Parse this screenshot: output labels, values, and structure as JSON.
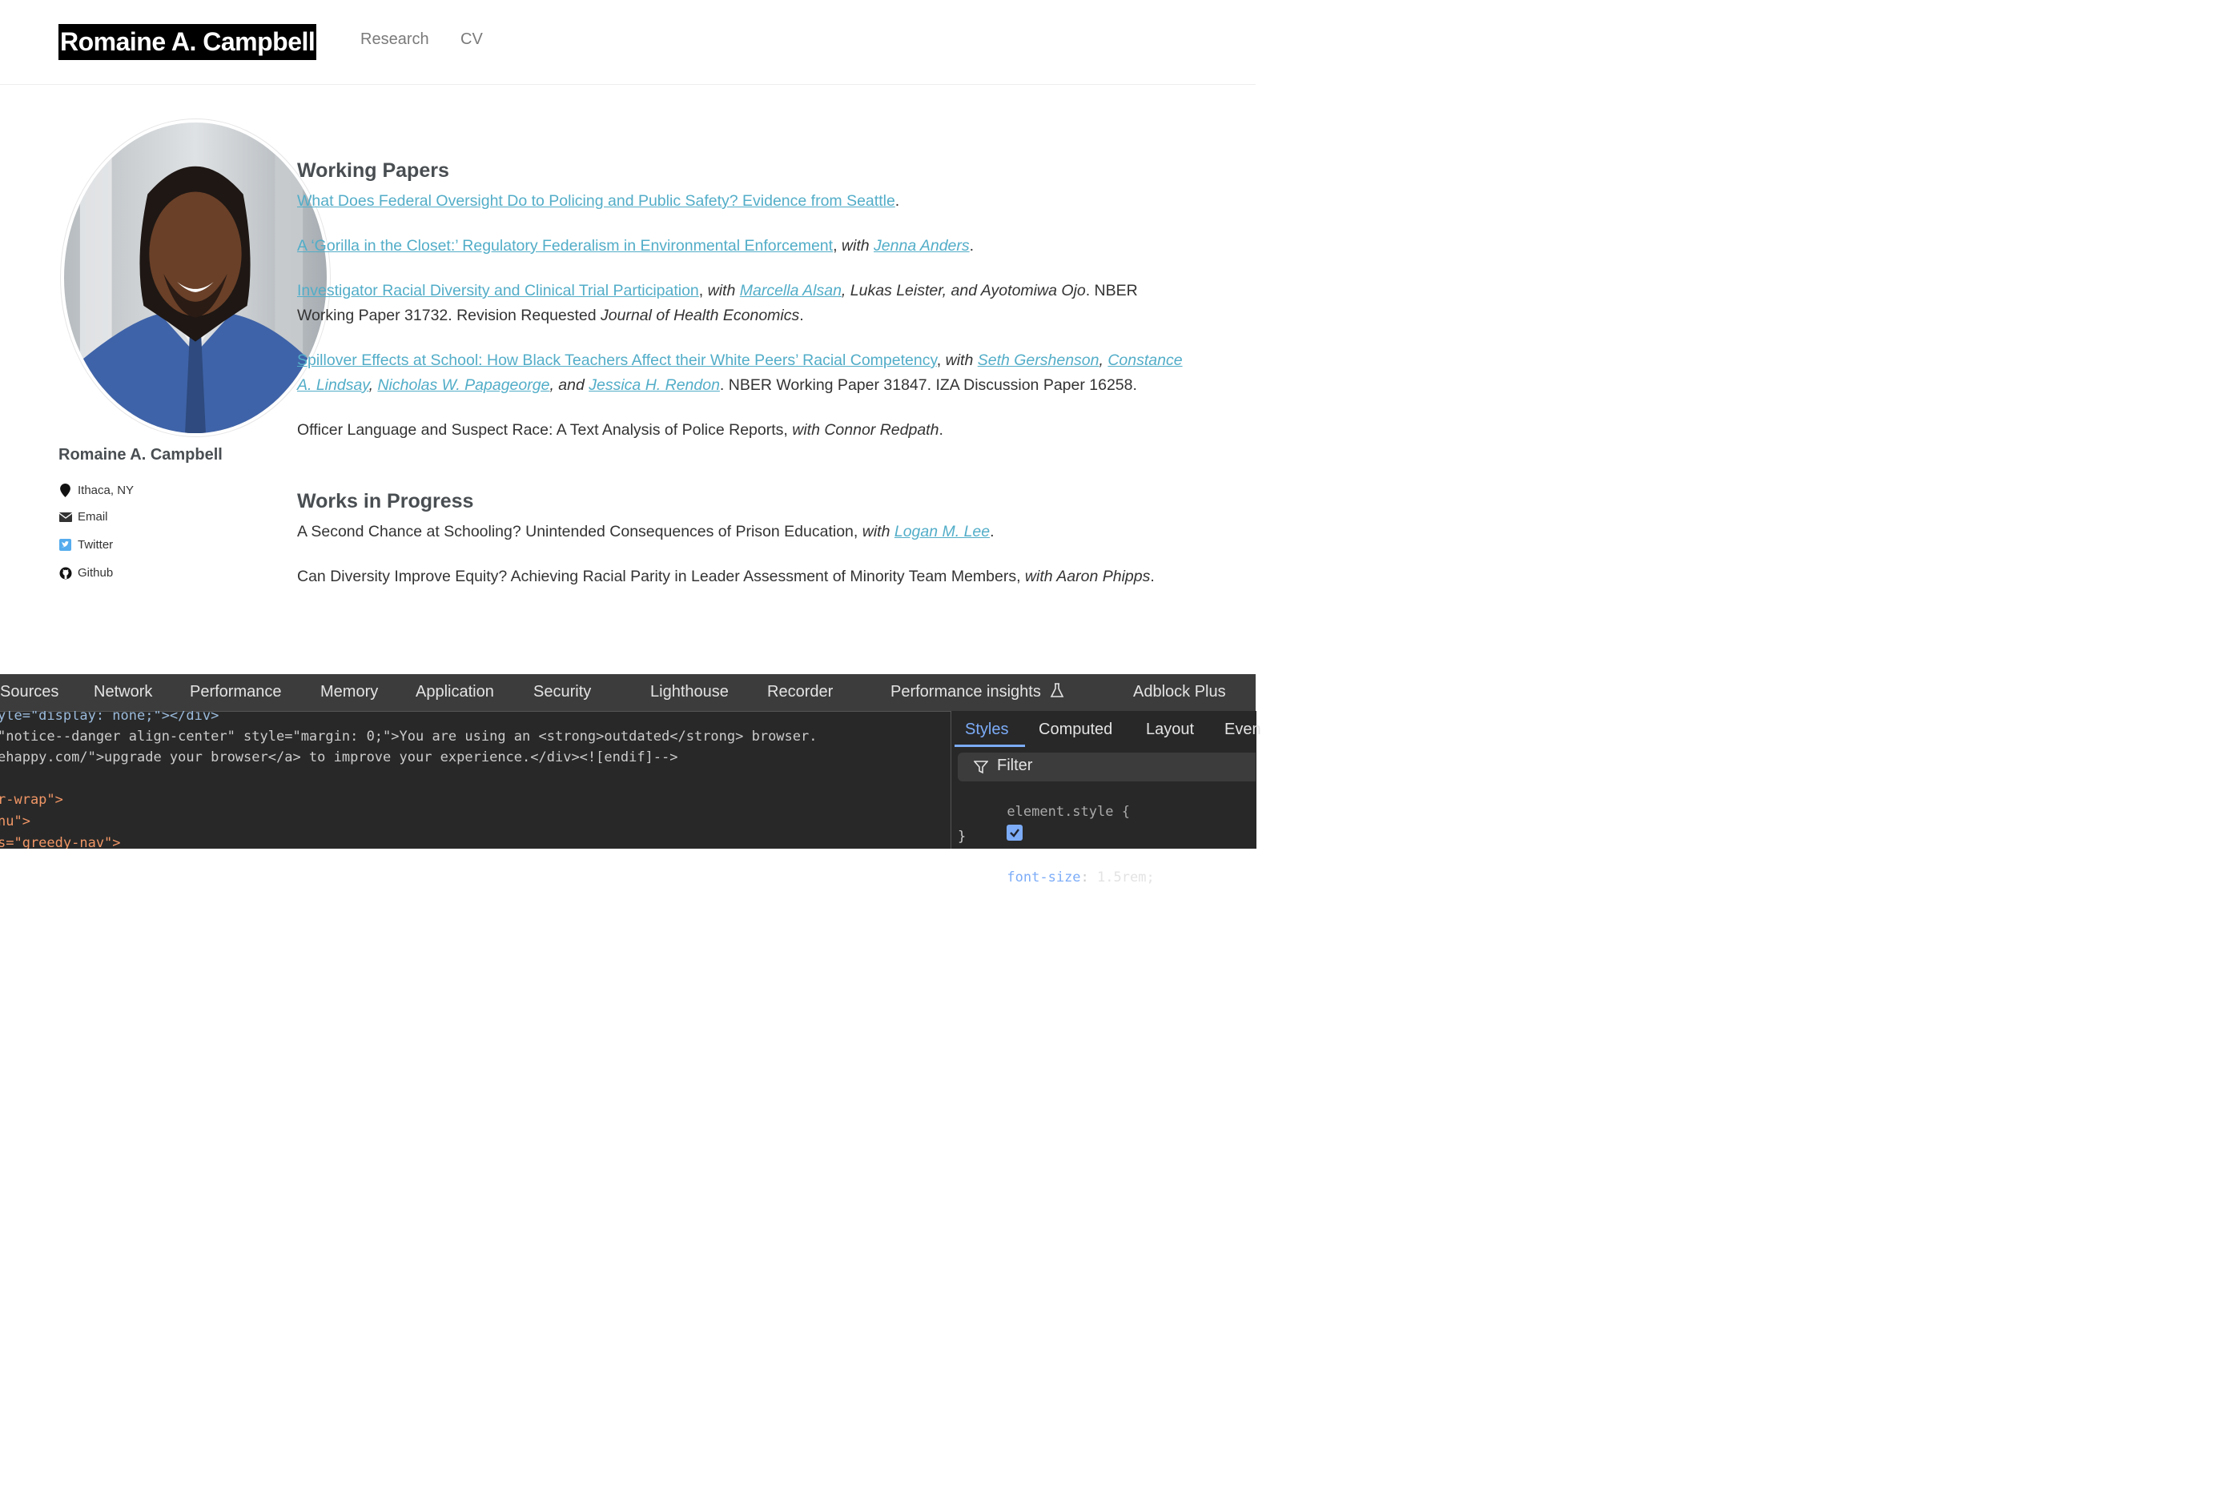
{
  "header": {
    "site_title": "Romaine A. Campbell",
    "nav": [
      {
        "label": "Research"
      },
      {
        "label": "CV"
      }
    ]
  },
  "sidebar": {
    "name": "Romaine A. Campbell",
    "links": [
      {
        "label": "Ithaca, NY",
        "icon": "map-marker-icon"
      },
      {
        "label": "Email",
        "icon": "envelope-icon"
      },
      {
        "label": "Twitter",
        "icon": "twitter-icon"
      },
      {
        "label": "Github",
        "icon": "github-icon"
      }
    ]
  },
  "main": {
    "working_papers_heading": "Working Papers",
    "wp1": {
      "title": "What Does Federal Oversight Do to Policing and Public Safety? Evidence from Seattle"
    },
    "wp2": {
      "title": "A ‘Gorilla in the Closet:’ Regulatory Federalism in Environmental Enforcement",
      "with": "with",
      "coauthor": "Jenna Anders"
    },
    "wp3": {
      "title": "Investigator Racial Diversity and Clinical Trial Participation",
      "with": "with",
      "coauthor1": "Marcella Alsan",
      "rest": ", Lukas Leister, and Ayotomiwa Ojo",
      "note": ". NBER Working Paper 31732. Revision Requested ",
      "journal": "Journal of Health Economics"
    },
    "wp4": {
      "title": "Spillover Effects at School: How Black Teachers Affect their White Peers’ Racial Competency",
      "with": "with",
      "coauthors": [
        "Seth Gershenson",
        "Constance A. Lindsay",
        "Nicholas W. Papageorge",
        "Jessica H. Rendon"
      ],
      "and": "and",
      "note": ". NBER Working Paper 31847. IZA Discussion Paper 16258."
    },
    "wp5": {
      "title": "Officer Language and Suspect Race: A Text Analysis of Police Reports, ",
      "authors": "with Connor Redpath"
    },
    "works_in_progress_heading": "Works in Progress",
    "wip1": {
      "title": "A Second Chance at Schooling? Unintended Consequences of Prison Education, ",
      "with": "with",
      "coauthor": "Logan M. Lee"
    },
    "wip2": {
      "title": "Can Diversity Improve Equity? Achieving Racial Parity in Leader Assessment of Minority Team Members, ",
      "authors": "with Aaron Phipps"
    }
  },
  "devtools": {
    "tabs": [
      "Sources",
      "Network",
      "Performance",
      "Memory",
      "Application",
      "Security",
      "Lighthouse",
      "Recorder",
      "Performance insights",
      "Adblock Plus"
    ],
    "code_lines": [
      "yle=\"display: none;\"></div>",
      "\"notice--danger align-center\" style=\"margin: 0;\">You are using an <strong>outdated</strong> browser.",
      "ehappy.com/\">upgrade your browser</a> to improve your experience.</div><![endif]-->",
      "",
      "r-wrap\">",
      "nu\">",
      "s=\"greedy-nav\">"
    ],
    "styles_tabs": [
      "Styles",
      "Computed",
      "Layout",
      "Even"
    ],
    "filter_placeholder": "Filter",
    "element_style": "element.style {",
    "declaration_prop": "font-size",
    "declaration_value": "1.5rem;",
    "closing_brace": "}"
  }
}
